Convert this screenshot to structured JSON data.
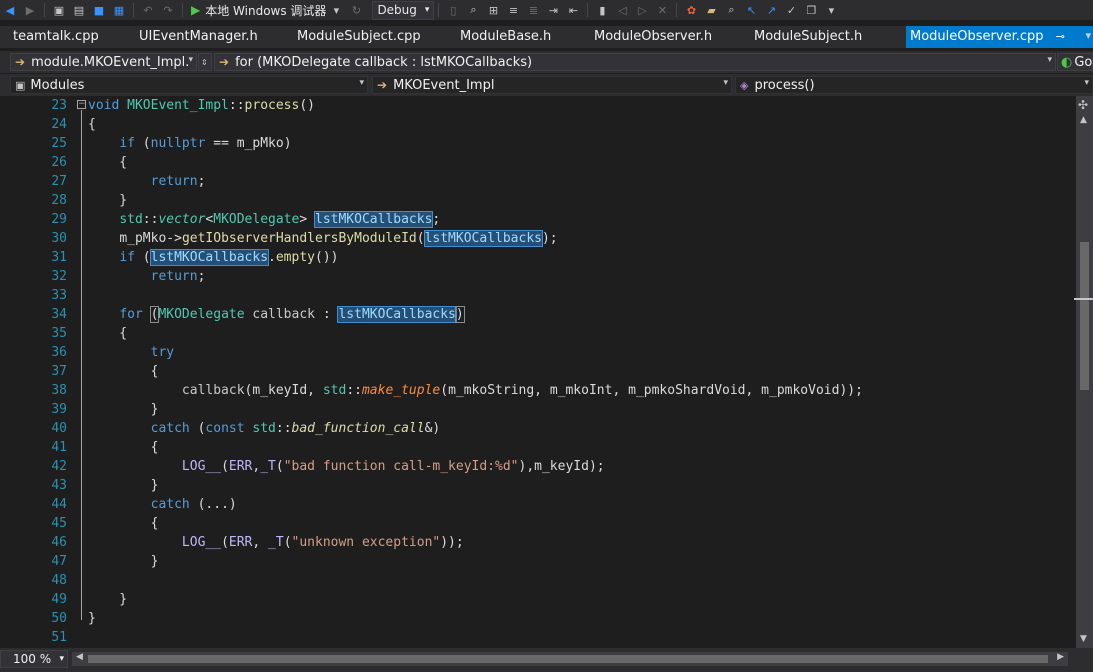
{
  "toolbar": {
    "run_label": "本地 Windows 调试器",
    "config_value": "Debug"
  },
  "tabs": [
    {
      "label": "teamtalk.cpp"
    },
    {
      "label": "UIEventManager.h"
    },
    {
      "label": "ModuleSubject.cpp"
    },
    {
      "label": "ModuleBase.h"
    },
    {
      "label": "ModuleObserver.h"
    },
    {
      "label": "ModuleSubject.h"
    },
    {
      "label": "ModuleObserver.cpp",
      "active": true
    }
  ],
  "nav1": {
    "scope": "module.MKOEvent_Impl.",
    "context": "for (MKODelegate callback : lstMKOCallbacks)",
    "go_label": "Go"
  },
  "nav2": {
    "project": "Modules",
    "class": "MKOEvent_Impl",
    "member": "process()"
  },
  "editor": {
    "zoom": "100 %",
    "line_numbers": [
      "23",
      "24",
      "25",
      "26",
      "27",
      "28",
      "29",
      "30",
      "31",
      "32",
      "33",
      "34",
      "35",
      "36",
      "37",
      "38",
      "39",
      "40",
      "41",
      "42",
      "43",
      "44",
      "45",
      "46",
      "47",
      "48",
      "49",
      "50",
      "51"
    ],
    "highlighted_symbol": "lstMKOCallbacks"
  },
  "colors": {
    "keyword": "#569cd6",
    "function": "#dcdcaa",
    "type": "#4ec9b0",
    "string": "#d69d85",
    "macro": "#beb7ff",
    "line_number": "#2b91af",
    "selection": "#264f78",
    "active_tab": "#007acc"
  }
}
